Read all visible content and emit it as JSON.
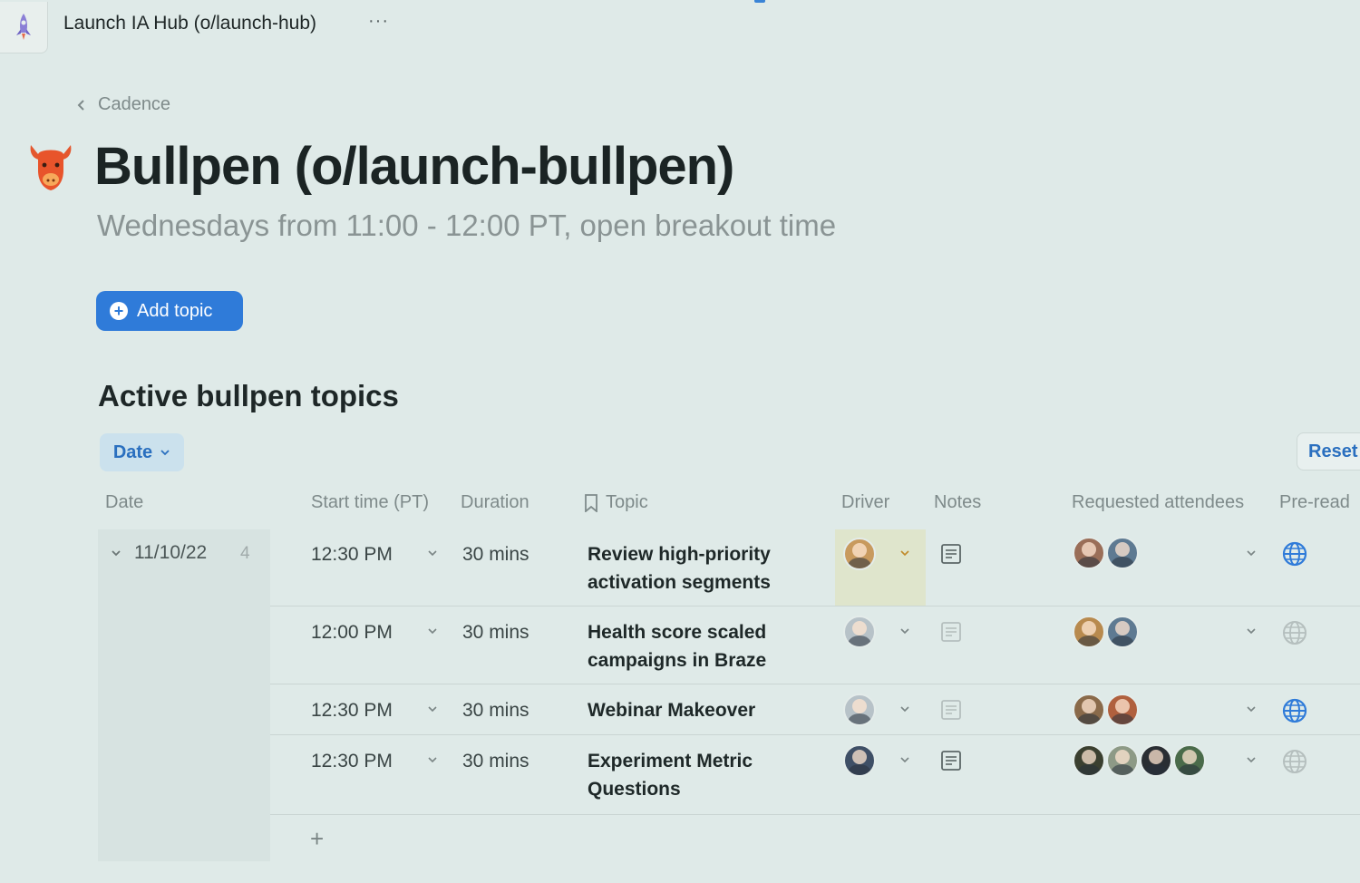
{
  "header": {
    "doc_title": "Launch IA Hub (o/launch-hub)",
    "more_label": "···"
  },
  "breadcrumb": {
    "label": "Cadence"
  },
  "page": {
    "title": "Bullpen (o/launch-bullpen)",
    "subtitle": "Wednesdays from 11:00 - 12:00 PT, open breakout time",
    "add_topic_label": "Add topic"
  },
  "section": {
    "title": "Active bullpen topics",
    "filter_label": "Date",
    "reset_label": "Reset"
  },
  "table": {
    "columns": {
      "date": "Date",
      "start": "Start time (PT)",
      "duration": "Duration",
      "topic": "Topic",
      "driver": "Driver",
      "notes": "Notes",
      "attendees": "Requested attendees",
      "preread": "Pre-read"
    },
    "group": {
      "label": "11/10/22",
      "count": "4"
    },
    "rows": [
      {
        "start": "12:30 PM",
        "duration": "30 mins",
        "topic": "Review high-priority activation segments",
        "preread_active": true
      },
      {
        "start": "12:00 PM",
        "duration": "30 mins",
        "topic": "Health score scaled campaigns in Braze",
        "preread_active": false
      },
      {
        "start": "12:30 PM",
        "duration": "30 mins",
        "topic": "Webinar Makeover",
        "preread_active": true
      },
      {
        "start": "12:30 PM",
        "duration": "30 mins",
        "topic": "Experiment Metric Questions",
        "preread_active": false
      }
    ],
    "add_row_label": "+"
  },
  "colors": {
    "accent": "#2f7bd9",
    "background": "#dfeae8",
    "filter_chip": "#cbe1ed",
    "driver_highlight": "#dfe5cc"
  },
  "icons": [
    "rocket-icon",
    "more-icon",
    "chevron-left-icon",
    "bull-icon",
    "plus-circle-icon",
    "chevron-down-icon",
    "bookmark-icon",
    "notes-icon",
    "globe-icon",
    "avatar"
  ]
}
